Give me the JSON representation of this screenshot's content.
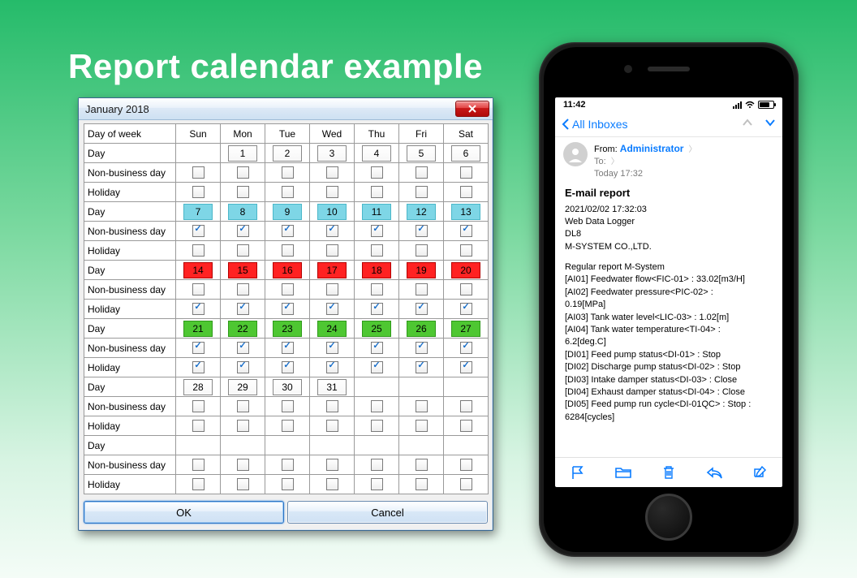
{
  "page": {
    "title": "Report calendar example"
  },
  "dialog": {
    "title": "January 2018",
    "headers": {
      "label": "Day of week",
      "days": [
        "Sun",
        "Mon",
        "Tue",
        "Wed",
        "Thu",
        "Fri",
        "Sat"
      ]
    },
    "row_labels": {
      "day": "Day",
      "nbd": "Non-business day",
      "hol": "Holiday"
    },
    "weeks": [
      {
        "color": "none",
        "days": [
          "",
          "1",
          "2",
          "3",
          "4",
          "5",
          "6"
        ],
        "nbd": [
          false,
          false,
          false,
          false,
          false,
          false,
          false
        ],
        "hol": [
          false,
          false,
          false,
          false,
          false,
          false,
          false
        ]
      },
      {
        "color": "cyan",
        "days": [
          "7",
          "8",
          "9",
          "10",
          "11",
          "12",
          "13"
        ],
        "nbd": [
          true,
          true,
          true,
          true,
          true,
          true,
          true
        ],
        "hol": [
          false,
          false,
          false,
          false,
          false,
          false,
          false
        ]
      },
      {
        "color": "red",
        "days": [
          "14",
          "15",
          "16",
          "17",
          "18",
          "19",
          "20"
        ],
        "nbd": [
          false,
          false,
          false,
          false,
          false,
          false,
          false
        ],
        "hol": [
          true,
          true,
          true,
          true,
          true,
          true,
          true
        ]
      },
      {
        "color": "green",
        "days": [
          "21",
          "22",
          "23",
          "24",
          "25",
          "26",
          "27"
        ],
        "nbd": [
          true,
          true,
          true,
          true,
          true,
          true,
          true
        ],
        "hol": [
          true,
          true,
          true,
          true,
          true,
          true,
          true
        ]
      },
      {
        "color": "none",
        "days": [
          "28",
          "29",
          "30",
          "31",
          "",
          "",
          ""
        ],
        "nbd": [
          false,
          false,
          false,
          false,
          false,
          false,
          false
        ],
        "hol": [
          false,
          false,
          false,
          false,
          false,
          false,
          false
        ]
      },
      {
        "color": "none",
        "days": [
          "",
          "",
          "",
          "",
          "",
          "",
          ""
        ],
        "nbd": [
          false,
          false,
          false,
          false,
          false,
          false,
          false
        ],
        "hol": [
          false,
          false,
          false,
          false,
          false,
          false,
          false
        ]
      }
    ],
    "buttons": {
      "ok": "OK",
      "cancel": "Cancel"
    }
  },
  "phone": {
    "status_time": "11:42",
    "nav_back": "All Inboxes",
    "from_label": "From:",
    "from_name": "Administrator",
    "to_label": "To:",
    "date_line": "Today 17:32",
    "subject": "E-mail report",
    "body_block1": [
      "2021/02/02 17:32:03",
      "Web Data Logger",
      "DL8",
      "M-SYSTEM CO.,LTD."
    ],
    "body_block2": [
      "Regular report M-System",
      "[AI01] Feedwater flow<FIC-01> : 33.02[m3/H]",
      "[AI02] Feedwater pressure<PIC-02> :",
      "0.19[MPa]",
      "[AI03] Tank water level<LIC-03> : 1.02[m]",
      "[AI04] Tank water temperature<TI-04> :",
      "6.2[deg.C]",
      "[DI01] Feed pump status<DI-01> : Stop",
      "[DI02] Discharge pump status<DI-02> : Stop",
      "[DI03] Intake damper status<DI-03> : Close",
      "[DI04] Exhaust damper status<DI-04> : Close",
      "[DI05] Feed pump run cycle<DI-01QC> : Stop :",
      "6284[cycles]"
    ]
  }
}
